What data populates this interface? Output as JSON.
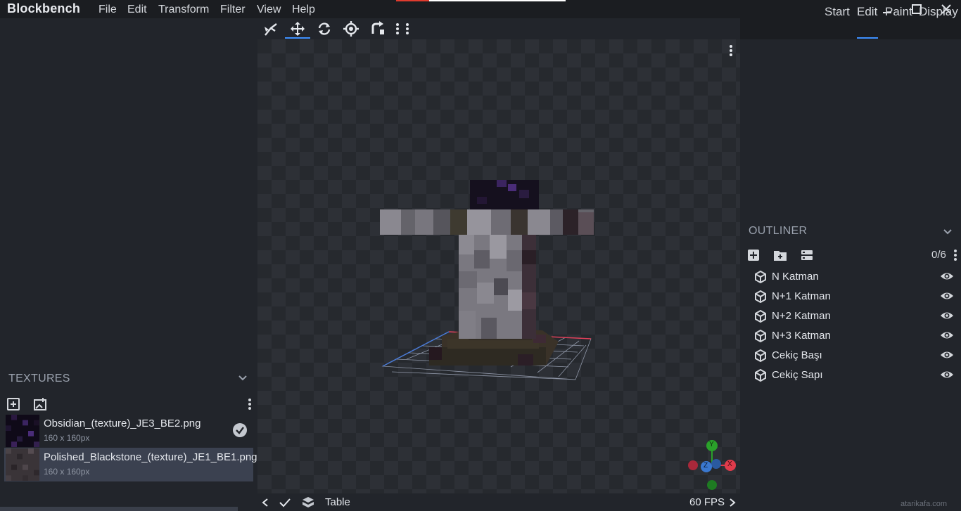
{
  "app": {
    "title": "Blockbench"
  },
  "menu": [
    "File",
    "Edit",
    "Transform",
    "Filter",
    "View",
    "Help"
  ],
  "modes": {
    "items": [
      "Start",
      "Edit",
      "Paint",
      "Display"
    ],
    "active": "Edit"
  },
  "textures": {
    "header": "TEXTURES",
    "items": [
      {
        "name": "Obsidian_(texture)_JE3_BE2.png",
        "size": "160 x 160px",
        "selected": false
      },
      {
        "name": "Polished_Blackstone_(texture)_JE1_BE1.png",
        "size": "160 x 160px",
        "selected": true
      }
    ]
  },
  "outliner": {
    "header": "OUTLINER",
    "count": "0/6",
    "items": [
      "N Katman",
      "N+1 Katman",
      "N+2 Katman",
      "N+3 Katman",
      "Cekiç Başı",
      "Cekiç Sapı"
    ]
  },
  "viewport": {
    "gizmo_labels": {
      "y": "Y",
      "x": "X",
      "z": "Z"
    }
  },
  "status": {
    "label": "Table",
    "fps": "60 FPS"
  },
  "watermark": "atarikafa.com",
  "colors": {
    "accent": "#3e90ff",
    "panel": "#22252b",
    "x_axis": "#e03b4b",
    "y_axis": "#2aa12a",
    "z_axis": "#3a78d0"
  }
}
